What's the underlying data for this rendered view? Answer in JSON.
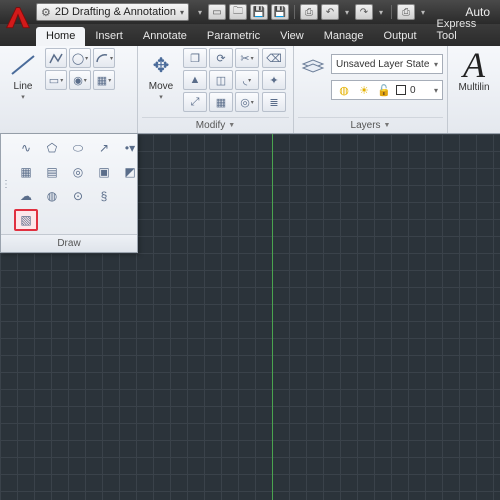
{
  "title_suffix": "Auto",
  "workspace": {
    "label": "2D Drafting & Annotation"
  },
  "tabs": [
    "Home",
    "Insert",
    "Annotate",
    "Parametric",
    "View",
    "Manage",
    "Output",
    "Express Tool"
  ],
  "active_tab": "Home",
  "panels": {
    "draw": {
      "title": "Draw",
      "line_label": "Line"
    },
    "modify": {
      "title": "Modify",
      "move_label": "Move"
    },
    "layers": {
      "title": "Layers",
      "state_label": "Unsaved Layer State",
      "current_layer": "0"
    },
    "annotation": {
      "label": "Multilin"
    }
  },
  "draw_flyout": {
    "title": "Draw"
  },
  "qat_icons": [
    "new-icon",
    "open-icon",
    "save-icon",
    "saveas-icon",
    "plot-icon",
    "undo-icon",
    "redo-icon",
    "print-icon"
  ]
}
